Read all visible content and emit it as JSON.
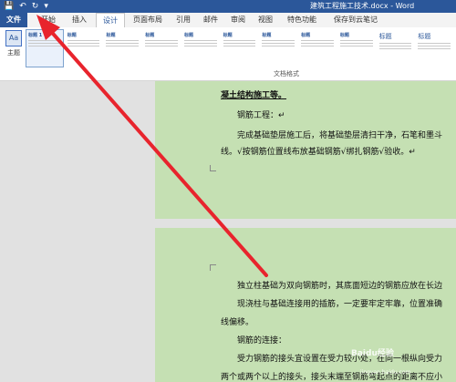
{
  "window": {
    "title": "建筑工程施工技术.docx - Word"
  },
  "qat": {
    "save": "💾",
    "undo": "↶",
    "redo": "↻",
    "customize": "▾"
  },
  "tabs": [
    {
      "label": "文件"
    },
    {
      "label": "开始"
    },
    {
      "label": "插入"
    },
    {
      "label": "设计"
    },
    {
      "label": "页面布局"
    },
    {
      "label": "引用"
    },
    {
      "label": "邮件"
    },
    {
      "label": "审阅"
    },
    {
      "label": "视图"
    },
    {
      "label": "特色功能"
    },
    {
      "label": "保存到云笔记"
    }
  ],
  "ribbon": {
    "theme_label": "主题",
    "gallery_label": "文档格式",
    "styles": [
      {
        "h": "标题 1"
      },
      {
        "h": "标题"
      },
      {
        "h": "标题"
      },
      {
        "h": "标题"
      },
      {
        "h": "标题"
      },
      {
        "h": "标题"
      },
      {
        "h": "标题"
      },
      {
        "h": "标题"
      },
      {
        "h": "标题"
      },
      {
        "h": "标题"
      },
      {
        "h": "标题"
      }
    ]
  },
  "doc": {
    "page1": [
      "凝土结构施工等。",
      "钢筋工程：↵",
      "完成基础垫层施工后，将基础垫层清扫干净，石笔和墨斗",
      "线。√按钢筋位置线布放基础钢筋√绑扎钢筋√验收。↵"
    ],
    "page2": [
      "独立柱基础为双向钢筋时，其底面短边的钢筋应放在长边",
      "现浇柱与基础连接用的插筋，一定要牢定牢靠，位置准确",
      "线偏移。",
      "钢筋的连接：",
      "受力钢筋的接头宜设置在受力较小处，在同一根纵向受力",
      "两个或两个以上的接头，接头末端至钢筋弯起点的距离不应小"
    ]
  },
  "watermark": {
    "brand": "Baidu经验",
    "url": "jingyan.baidu.com"
  }
}
